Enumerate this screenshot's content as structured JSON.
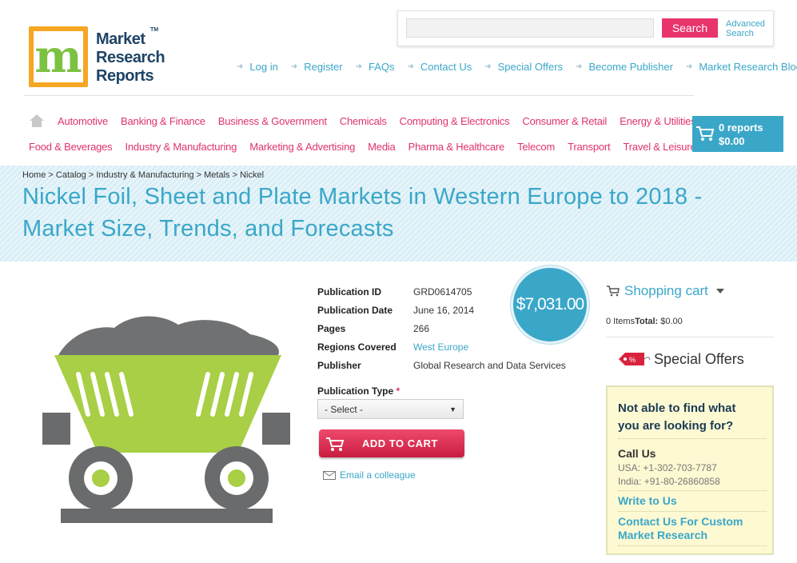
{
  "logo": {
    "letter_m": "m",
    "line1": "Market",
    "line2": "Research",
    "line3": "Reports",
    "tm": "TM"
  },
  "search": {
    "placeholder": "",
    "button_label": "Search",
    "advanced_line1": "Advanced",
    "advanced_line2": "Search"
  },
  "top_links": [
    "Log in",
    "Register",
    "FAQs",
    "Contact Us",
    "Special Offers",
    "Become Publisher",
    "Market Research Blog"
  ],
  "categories_row1": [
    "Automotive",
    "Banking & Finance",
    "Business & Government",
    "Chemicals",
    "Computing & Electronics",
    "Consumer & Retail",
    "Energy & Utilities"
  ],
  "categories_row2": [
    "Food & Beverages",
    "Industry & Manufacturing",
    "Marketing & Advertising",
    "Media",
    "Pharma & Healthcare",
    "Telecom",
    "Transport",
    "Travel & Leisure"
  ],
  "cart": {
    "count": "0 reports",
    "total": "$0.00"
  },
  "breadcrumb": "Home > Catalog > Industry & Manufacturing > Metals > Nickel",
  "title": "Nickel Foil, Sheet and Plate Markets in Western Europe to 2018 - Market Size, Trends, and Forecasts",
  "details": {
    "pub_id_label": "Publication ID",
    "pub_id": "GRD0614705",
    "pub_date_label": "Publication Date",
    "pub_date": "June 16, 2014",
    "pages_label": "Pages",
    "pages": "266",
    "regions_label": "Regions Covered",
    "regions": "West Europe",
    "publisher_label": "Publisher",
    "publisher": "Global Research and Data Services"
  },
  "price": "$7,031.00",
  "publication_type": {
    "label": "Publication Type",
    "required": "*",
    "selected": "- Select -"
  },
  "add_to_cart": "ADD TO CART",
  "email_colleague": "Email a colleague",
  "sidebar": {
    "shopping_cart": "Shopping cart",
    "items_label": "0 Items",
    "total_label": "Total:",
    "total_value": "$0.00",
    "special_offers": "Special Offers",
    "help_question_line1": "Not able to find what",
    "help_question_line2": "you are looking for?",
    "call_us": "Call Us",
    "phone_usa": "USA: +1-302-703-7787",
    "phone_india": "India: +91-80-26860858",
    "write_to_us": "Write to Us",
    "custom_line1": "Contact Us For Custom",
    "custom_line2": "Market Research"
  },
  "colors": {
    "accent_blue": "#3aa7c9",
    "accent_pink": "#e0336b",
    "logo_orange": "#f5a623",
    "cart_green": "#a8cf45"
  }
}
